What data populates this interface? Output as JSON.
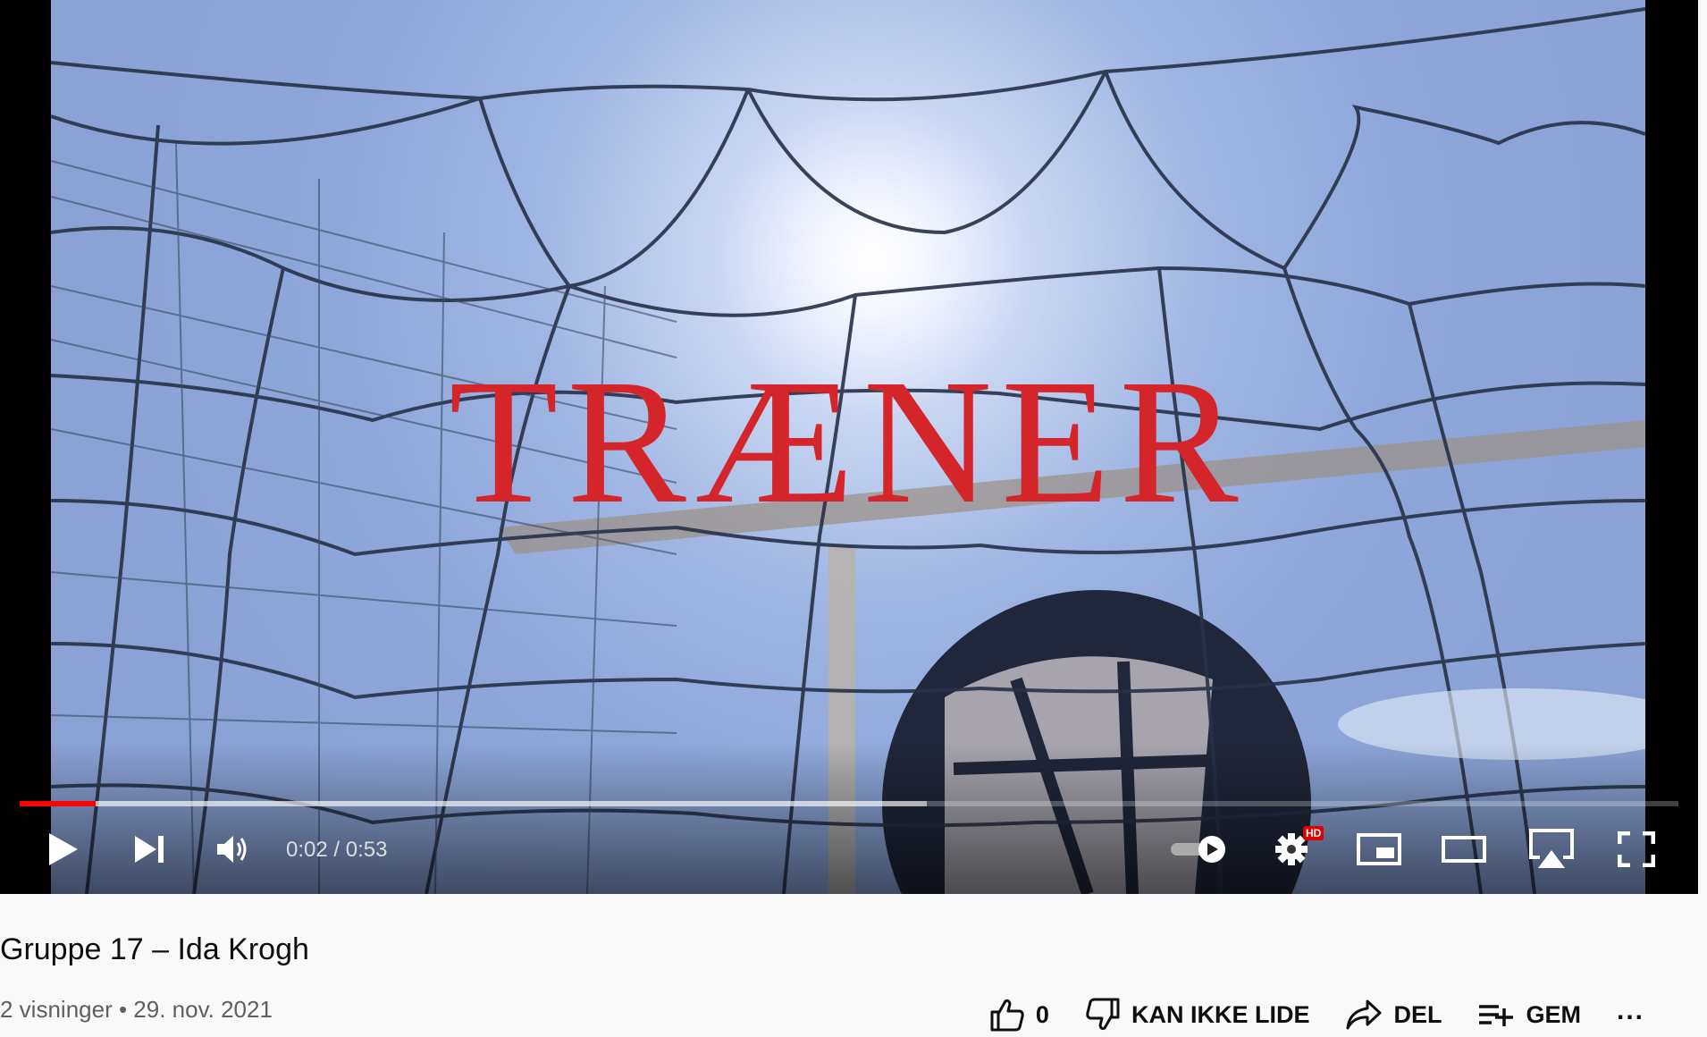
{
  "video": {
    "overlay_title": "TRÆNER",
    "current_time": "0:02",
    "duration": "0:53",
    "time_separator": " / ",
    "played_fraction": 0.046,
    "buffered_fraction": 0.547,
    "hd_badge": "HD"
  },
  "controls": {
    "icons": [
      "play-icon",
      "next-icon",
      "volume-icon",
      "autoplay-toggle-icon",
      "settings-icon",
      "miniplayer-icon",
      "theater-mode-icon",
      "airplay-icon",
      "fullscreen-icon"
    ]
  },
  "info": {
    "title": "Gruppe 17 – Ida Krogh",
    "views": "2 visninger",
    "separator": " • ",
    "date": "29. nov. 2021"
  },
  "actions": {
    "like_count": "0",
    "dislike_label": "KAN IKKE LIDE",
    "share_label": "DEL",
    "save_label": "GEM",
    "more_label": "..."
  },
  "colors": {
    "progress_played": "#ff0000",
    "overlay_title": "#d4262a",
    "hd_badge": "#dd0000"
  }
}
